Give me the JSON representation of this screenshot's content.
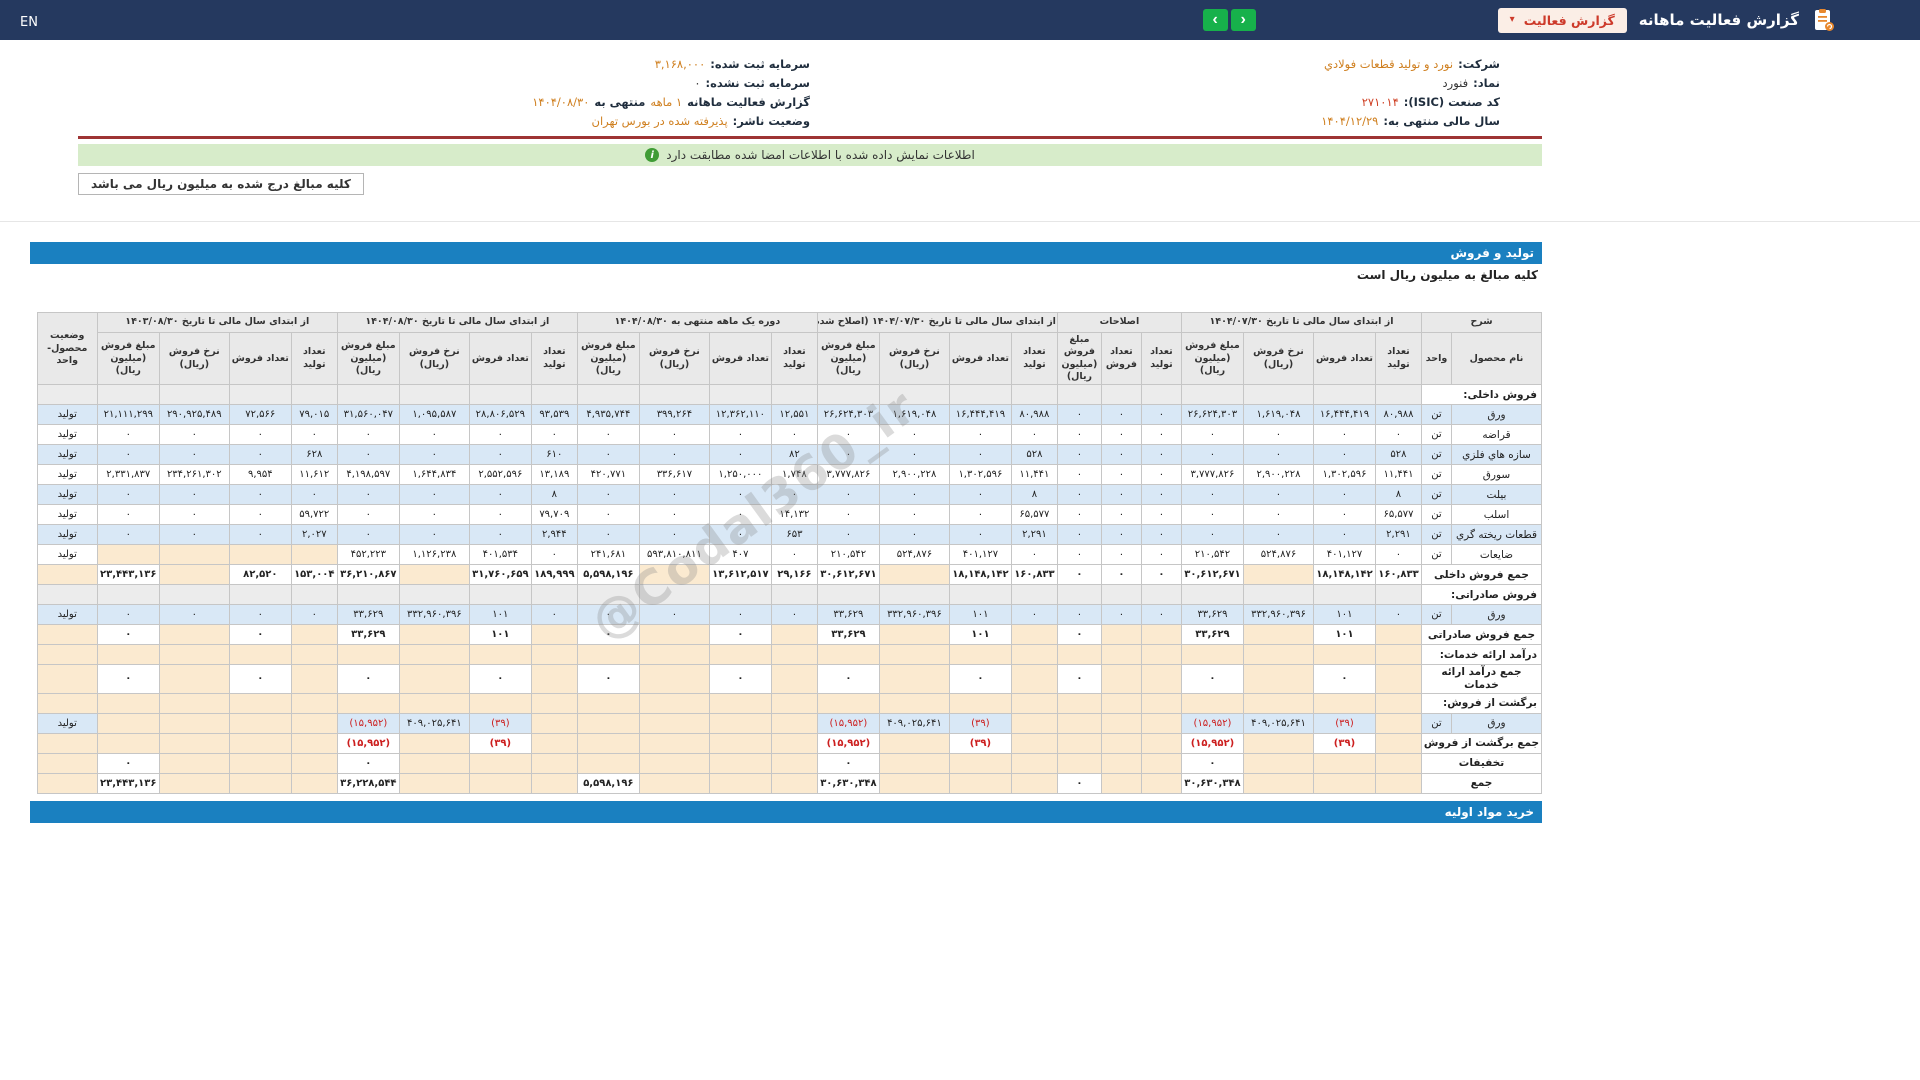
{
  "navbar": {
    "lang": "EN",
    "title": "گزارش فعالیت ماهانه",
    "dropdown": "گزارش فعالیت",
    "caret": "▾",
    "prev_arrow": "‹",
    "next_arrow": "›"
  },
  "info": {
    "right": [
      {
        "label": "شرکت:",
        "value": "نورد و تولید قطعات فولادي",
        "style": "link"
      },
      {
        "label": "نماد:",
        "value": "فنورد",
        "style": "plain"
      },
      {
        "label": "کد صنعت (ISIC):",
        "value": "۲۷۱۰۱۴",
        "style": "red"
      },
      {
        "label": "سال مالی منتهی به:",
        "value": "۱۴۰۴/۱۲/۲۹",
        "style": "link"
      }
    ],
    "left": [
      {
        "label": "سرمایه ثبت شده:",
        "value": "۳,۱۶۸,۰۰۰",
        "style": "link"
      },
      {
        "label": "سرمایه ثبت نشده:",
        "value": "۰",
        "style": "plain"
      },
      {
        "label": "گزارش فعالیت ماهانه",
        "value": "۱ ماهه",
        "label2": "منتهی به",
        "value2": "۱۴۰۴/۰۸/۳۰",
        "style": "link"
      },
      {
        "label": "وضعیت ناشر:",
        "value": "پذیرفته شده در بورس تهران",
        "style": "link"
      }
    ]
  },
  "banner": "اطلاعات نمایش داده شده با اطلاعات امضا شده مطابقت دارد",
  "banner_icon": "i",
  "note": "کلیه مبالغ درج شده به میلیون ریال می باشد",
  "watermark": "@Codal360_ir",
  "production_table": {
    "title": "تولید و فروش",
    "subtitle": "کلیه مبالغ به میلیون ریال است",
    "bottom_bar": "خرید مواد اولیه",
    "header": {
      "desc": "شرح",
      "product": "نام محصول",
      "unit": "واحد",
      "status": "وضعیت محصول-واحد",
      "sub": [
        "تعداد تولید",
        "تعداد فروش",
        "نرخ فروش (ریال)",
        "مبلغ فروش (میلیون ریال)"
      ],
      "sub_adj": [
        "تعداد تولید",
        "تعداد فروش",
        "مبلغ فروش (میلیون ریال)"
      ],
      "groups": [
        {
          "label": "از ابتدای سال مالی تا تاریخ ۱۴۰۴/۰۷/۳۰",
          "cols": 4
        },
        {
          "label": "اصلاحات",
          "cols": 3
        },
        {
          "label": "از ابتدای سال مالی تا تاریخ ۱۴۰۴/۰۷/۳۰ (اصلاح شده)",
          "cols": 4
        },
        {
          "label": "دوره یک ماهه منتهی به ۱۴۰۴/۰۸/۳۰",
          "cols": 4
        },
        {
          "label": "از ابتدای سال مالی تا تاریخ ۱۴۰۴/۰۸/۳۰",
          "cols": 4
        },
        {
          "label": "از ابتدای سال مالی تا تاریخ ۱۴۰۳/۰۸/۳۰",
          "cols": 4
        }
      ]
    },
    "rows": [
      {
        "type": "section",
        "label": "فروش داخلی:",
        "shade": "gray"
      },
      {
        "type": "product",
        "name": "ورق",
        "unit": "تن",
        "status": "تولید",
        "cells": [
          "۸۰,۹۸۸",
          "۱۶,۴۴۴,۴۱۹",
          "۱,۶۱۹,۰۴۸",
          "۲۶,۶۲۴,۳۰۳",
          "۰",
          "۰",
          "۰",
          "۸۰,۹۸۸",
          "۱۶,۴۴۴,۴۱۹",
          "۱,۶۱۹,۰۴۸",
          "۲۶,۶۲۴,۳۰۳",
          "۱۲,۵۵۱",
          "۱۲,۳۶۲,۱۱۰",
          "۳۹۹,۲۶۴",
          "۴,۹۳۵,۷۴۴",
          "۹۳,۵۳۹",
          "۲۸,۸۰۶,۵۲۹",
          "۱,۰۹۵,۵۸۷",
          "۳۱,۵۶۰,۰۴۷",
          "۷۹,۰۱۵",
          "۷۲,۵۶۶",
          "۲۹۰,۹۲۵,۴۸۹",
          "۲۱,۱۱۱,۲۹۹"
        ]
      },
      {
        "type": "product",
        "name": "قراضه",
        "unit": "تن",
        "status": "تولید",
        "cells": [
          "۰",
          "۰",
          "۰",
          "۰",
          "۰",
          "۰",
          "۰",
          "۰",
          "۰",
          "۰",
          "۰",
          "۰",
          "۰",
          "۰",
          "۰",
          "۰",
          "۰",
          "۰",
          "۰",
          "۰",
          "۰",
          "۰",
          "۰"
        ]
      },
      {
        "type": "product",
        "name": "سازه هاي فلزي",
        "unit": "تن",
        "status": "تولید",
        "cells": [
          "۵۲۸",
          "۰",
          "۰",
          "۰",
          "۰",
          "۰",
          "۰",
          "۵۲۸",
          "۰",
          "۰",
          "۰",
          "۸۲",
          "۰",
          "۰",
          "۰",
          "۶۱۰",
          "۰",
          "۰",
          "۰",
          "۶۲۸",
          "۰",
          "۰",
          "۰"
        ]
      },
      {
        "type": "product",
        "name": "سورق",
        "unit": "تن",
        "status": "تولید",
        "cells": [
          "۱۱,۴۴۱",
          "۱,۳۰۲,۵۹۶",
          "۲,۹۰۰,۲۲۸",
          "۳,۷۷۷,۸۲۶",
          "۰",
          "۰",
          "۰",
          "۱۱,۴۴۱",
          "۱,۳۰۲,۵۹۶",
          "۲,۹۰۰,۲۲۸",
          "۳,۷۷۷,۸۲۶",
          "۱,۷۴۸",
          "۱,۲۵۰,۰۰۰",
          "۳۳۶,۶۱۷",
          "۴۲۰,۷۷۱",
          "۱۳,۱۸۹",
          "۲,۵۵۲,۵۹۶",
          "۱,۶۴۴,۸۳۴",
          "۴,۱۹۸,۵۹۷",
          "۱۱,۶۱۲",
          "۹,۹۵۴",
          "۲۳۴,۲۶۱,۳۰۲",
          "۲,۳۳۱,۸۳۷"
        ]
      },
      {
        "type": "product",
        "name": "بیلت",
        "unit": "تن",
        "status": "تولید",
        "cells": [
          "۸",
          "۰",
          "۰",
          "۰",
          "۰",
          "۰",
          "۰",
          "۸",
          "۰",
          "۰",
          "۰",
          "۰",
          "۰",
          "۰",
          "۰",
          "۸",
          "۰",
          "۰",
          "۰",
          "۰",
          "۰",
          "۰",
          "۰"
        ]
      },
      {
        "type": "product",
        "name": "اسلب",
        "unit": "تن",
        "status": "تولید",
        "cells": [
          "۶۵,۵۷۷",
          "۰",
          "۰",
          "۰",
          "۰",
          "۰",
          "۰",
          "۶۵,۵۷۷",
          "۰",
          "۰",
          "۰",
          "۱۴,۱۳۲",
          "۰",
          "۰",
          "۰",
          "۷۹,۷۰۹",
          "۰",
          "۰",
          "۰",
          "۵۹,۷۲۲",
          "۰",
          "۰",
          "۰"
        ]
      },
      {
        "type": "product",
        "name": "قطعات ریخته گري",
        "unit": "تن",
        "status": "تولید",
        "cells": [
          "۲,۲۹۱",
          "۰",
          "۰",
          "۰",
          "۰",
          "۰",
          "۰",
          "۲,۲۹۱",
          "۰",
          "۰",
          "۰",
          "۶۵۳",
          "۰",
          "۰",
          "۰",
          "۲,۹۴۴",
          "۰",
          "۰",
          "۰",
          "۲,۰۲۷",
          "۰",
          "۰",
          "۰"
        ]
      },
      {
        "type": "product",
        "name": "ضایعات",
        "unit": "تن",
        "status": "تولید",
        "cells": [
          "۰",
          "۴۰۱,۱۲۷",
          "۵۲۴,۸۷۶",
          "۲۱۰,۵۴۲",
          "۰",
          "۰",
          "۰",
          "۰",
          "۴۰۱,۱۲۷",
          "۵۲۴,۸۷۶",
          "۲۱۰,۵۴۲",
          "۰",
          "۴۰۷",
          "۵۹۳,۸۱۰,۸۱۱",
          "۲۴۱,۶۸۱",
          "۰",
          "۴۰۱,۵۳۴",
          "۱,۱۲۶,۲۳۸",
          "۴۵۲,۲۲۳",
          "",
          "",
          "",
          ""
        ]
      },
      {
        "type": "total",
        "label": "جمع فروش داخلی",
        "cells": [
          "۱۶۰,۸۳۳",
          "۱۸,۱۴۸,۱۴۲",
          "",
          "۳۰,۶۱۲,۶۷۱",
          "۰",
          "۰",
          "۰",
          "۱۶۰,۸۳۳",
          "۱۸,۱۴۸,۱۴۲",
          "",
          "۳۰,۶۱۲,۶۷۱",
          "۲۹,۱۶۶",
          "۱۳,۶۱۲,۵۱۷",
          "",
          "۵,۵۹۸,۱۹۶",
          "۱۸۹,۹۹۹",
          "۳۱,۷۶۰,۶۵۹",
          "",
          "۳۶,۲۱۰,۸۶۷",
          "۱۵۳,۰۰۴",
          "۸۲,۵۲۰",
          "",
          "۲۳,۴۴۳,۱۳۶"
        ]
      },
      {
        "type": "section",
        "label": "فروش صادراتی:",
        "shade": "gray"
      },
      {
        "type": "product",
        "name": "ورق",
        "unit": "تن",
        "status": "تولید",
        "cells": [
          "۰",
          "۱۰۱",
          "۳۳۲,۹۶۰,۳۹۶",
          "۳۳,۶۲۹",
          "۰",
          "۰",
          "۰",
          "۰",
          "۱۰۱",
          "۳۳۲,۹۶۰,۳۹۶",
          "۳۳,۶۲۹",
          "۰",
          "۰",
          "۰",
          "۰",
          "۰",
          "۱۰۱",
          "۳۳۲,۹۶۰,۳۹۶",
          "۳۳,۶۲۹",
          "۰",
          "۰",
          "۰",
          "۰"
        ]
      },
      {
        "type": "total",
        "label": "جمع فروش صادراتی",
        "cells": [
          "",
          "۱۰۱",
          "",
          "۳۳,۶۲۹",
          "",
          "",
          "۰",
          "",
          "۱۰۱",
          "",
          "۳۳,۶۲۹",
          "",
          "۰",
          "",
          "۰",
          "",
          "۱۰۱",
          "",
          "۳۳,۶۲۹",
          "",
          "۰",
          "",
          "۰"
        ]
      },
      {
        "type": "section",
        "label": "درآمد ارائه خدمات:",
        "shade": "cream"
      },
      {
        "type": "total",
        "label": "جمع درآمد ارائه خدمات",
        "cells": [
          "",
          "۰",
          "",
          "۰",
          "",
          "",
          "۰",
          "",
          "۰",
          "",
          "۰",
          "",
          "۰",
          "",
          "۰",
          "",
          "۰",
          "",
          "۰",
          "",
          "۰",
          "",
          "۰"
        ]
      },
      {
        "type": "section",
        "label": "برگشت از فروش:",
        "shade": "cream"
      },
      {
        "type": "product",
        "name": "ورق",
        "unit": "تن",
        "status": "تولید",
        "cells": [
          "",
          "(۳۹)",
          "۴۰۹,۰۲۵,۶۴۱",
          "(۱۵,۹۵۲)",
          "",
          "",
          "",
          "",
          "(۳۹)",
          "۴۰۹,۰۲۵,۶۴۱",
          "(۱۵,۹۵۲)",
          "",
          "",
          "",
          "",
          "",
          "(۳۹)",
          "۴۰۹,۰۲۵,۶۴۱",
          "(۱۵,۹۵۲)",
          "",
          "",
          "",
          ""
        ]
      },
      {
        "type": "total",
        "label": "جمع برگشت از فروش",
        "cells": [
          "",
          "(۳۹)",
          "",
          "(۱۵,۹۵۲)",
          "",
          "",
          "",
          "",
          "(۳۹)",
          "",
          "(۱۵,۹۵۲)",
          "",
          "",
          "",
          "",
          "",
          "(۳۹)",
          "",
          "(۱۵,۹۵۲)",
          "",
          "",
          "",
          ""
        ]
      },
      {
        "type": "total",
        "label": "تخفیفات",
        "cells": [
          "",
          "",
          "",
          "۰",
          "",
          "",
          "",
          "",
          "",
          "",
          "۰",
          "",
          "",
          "",
          "",
          "",
          "",
          "",
          "۰",
          "",
          "",
          "",
          "۰"
        ]
      },
      {
        "type": "total",
        "label": "جمع",
        "cells": [
          "",
          "",
          "",
          "۳۰,۶۳۰,۳۴۸",
          "",
          "",
          "۰",
          "",
          "",
          "",
          "۳۰,۶۳۰,۳۴۸",
          "",
          "",
          "",
          "۵,۵۹۸,۱۹۶",
          "",
          "",
          "",
          "۳۶,۲۲۸,۵۴۴",
          "",
          "",
          "",
          "۲۳,۴۴۳,۱۳۶"
        ]
      }
    ]
  }
}
